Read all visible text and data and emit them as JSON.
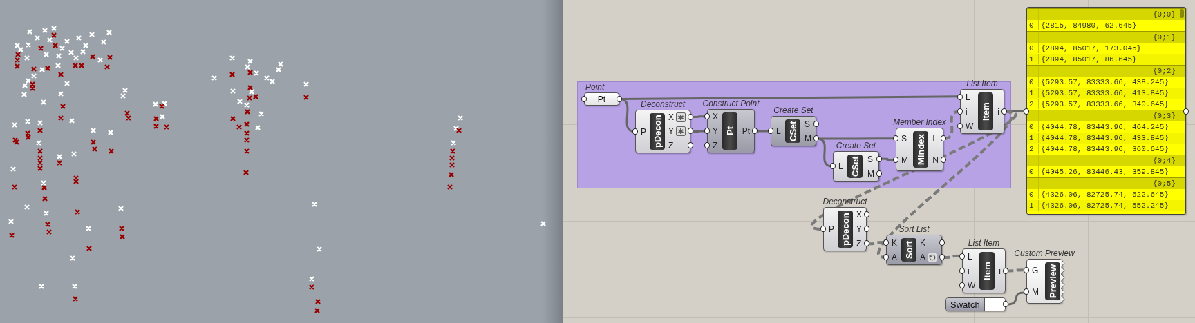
{
  "canvas": {
    "components": [
      {
        "kind": "param",
        "label": "Point",
        "nickname": "Pt"
      },
      {
        "kind": "component",
        "label": "Deconstruct",
        "nickname": "pDecon",
        "shaded": false,
        "inputs": [
          {
            "name": "P"
          }
        ],
        "outputs": [
          {
            "name": "X",
            "asterisk": true
          },
          {
            "name": "Y",
            "asterisk": true
          },
          {
            "name": "Z",
            "asterisk": false
          }
        ]
      },
      {
        "kind": "component",
        "label": "Construct Point",
        "nickname": "Pt",
        "shaded": true,
        "inputs": [
          {
            "name": "X"
          },
          {
            "name": "Y"
          },
          {
            "name": "Z"
          }
        ],
        "outputs": [
          {
            "name": "Pt"
          }
        ]
      },
      {
        "kind": "component",
        "label": "Create Set",
        "nickname": "CSet",
        "shaded": true,
        "inputs": [
          {
            "name": "L"
          }
        ],
        "outputs": [
          {
            "name": "S"
          },
          {
            "name": "M"
          }
        ]
      },
      {
        "kind": "component",
        "label": "Create Set",
        "nickname": "CSet",
        "shaded": false,
        "inputs": [
          {
            "name": "L"
          }
        ],
        "outputs": [
          {
            "name": "S"
          },
          {
            "name": "M"
          }
        ]
      },
      {
        "kind": "component",
        "label": "Member Index",
        "nickname": "MIndex",
        "shaded": false,
        "inputs": [
          {
            "name": "S"
          },
          {
            "name": "M"
          }
        ],
        "outputs": [
          {
            "name": "I"
          },
          {
            "name": "N"
          }
        ]
      },
      {
        "kind": "component",
        "label": "List Item",
        "nickname": "Item",
        "shaded": false,
        "inputs": [
          {
            "name": "L"
          },
          {
            "name": "i"
          },
          {
            "name": "W"
          }
        ],
        "outputs": [
          {
            "name": "i"
          }
        ]
      },
      {
        "kind": "component",
        "label": "Deconstruct",
        "nickname": "pDecon",
        "shaded": false,
        "inputs": [
          {
            "name": "P"
          }
        ],
        "outputs": [
          {
            "name": "X"
          },
          {
            "name": "Y"
          },
          {
            "name": "Z"
          }
        ]
      },
      {
        "kind": "component",
        "label": "Sort List",
        "nickname": "Sort",
        "shaded": true,
        "inputs": [
          {
            "name": "K"
          },
          {
            "name": "A"
          }
        ],
        "outputs": [
          {
            "name": "K",
            "reversed": false
          },
          {
            "name": "A",
            "reversed": true
          }
        ]
      },
      {
        "kind": "component",
        "label": "List Item",
        "nickname": "Item",
        "shaded": false,
        "inputs": [
          {
            "name": "L"
          },
          {
            "name": "i"
          },
          {
            "name": "W"
          }
        ],
        "outputs": [
          {
            "name": "i"
          }
        ]
      },
      {
        "kind": "preview",
        "label": "Custom Preview",
        "nickname": "Preview",
        "inputs": [
          {
            "name": "G"
          },
          {
            "name": "M"
          }
        ]
      },
      {
        "kind": "swatch",
        "label": "Swatch",
        "color": "#ffffff"
      }
    ],
    "panel": {
      "branches": [
        {
          "path": "{0;0}",
          "items": [
            {
              "index": "0",
              "text": "{2815, 84980, 62.645}"
            }
          ]
        },
        {
          "path": "{0;1}",
          "items": [
            {
              "index": "0",
              "text": "{2894, 85017, 173.045}"
            },
            {
              "index": "1",
              "text": "{2894, 85017, 86.645}"
            }
          ]
        },
        {
          "path": "{0;2}",
          "items": [
            {
              "index": "0",
              "text": "{5293.57, 83333.66, 438.245}"
            },
            {
              "index": "1",
              "text": "{5293.57, 83333.66, 413.845}"
            },
            {
              "index": "2",
              "text": "{5293.57, 83333.66, 340.645}"
            }
          ]
        },
        {
          "path": "{0;3}",
          "items": [
            {
              "index": "0",
              "text": "{4044.78, 83443.96, 464.245}"
            },
            {
              "index": "1",
              "text": "{4044.78, 83443.96, 433.845}"
            },
            {
              "index": "2",
              "text": "{4044.78, 83443.96, 360.645}"
            }
          ]
        },
        {
          "path": "{0;4}",
          "items": [
            {
              "index": "0",
              "text": "{4045.26, 83446.43, 359.845}"
            }
          ]
        },
        {
          "path": "{0;5}",
          "items": [
            {
              "index": "0",
              "text": "{4326.06, 82725.74, 622.645}"
            },
            {
              "index": "1",
              "text": "{4326.06, 82725.74, 552.245}"
            }
          ]
        }
      ]
    }
  }
}
